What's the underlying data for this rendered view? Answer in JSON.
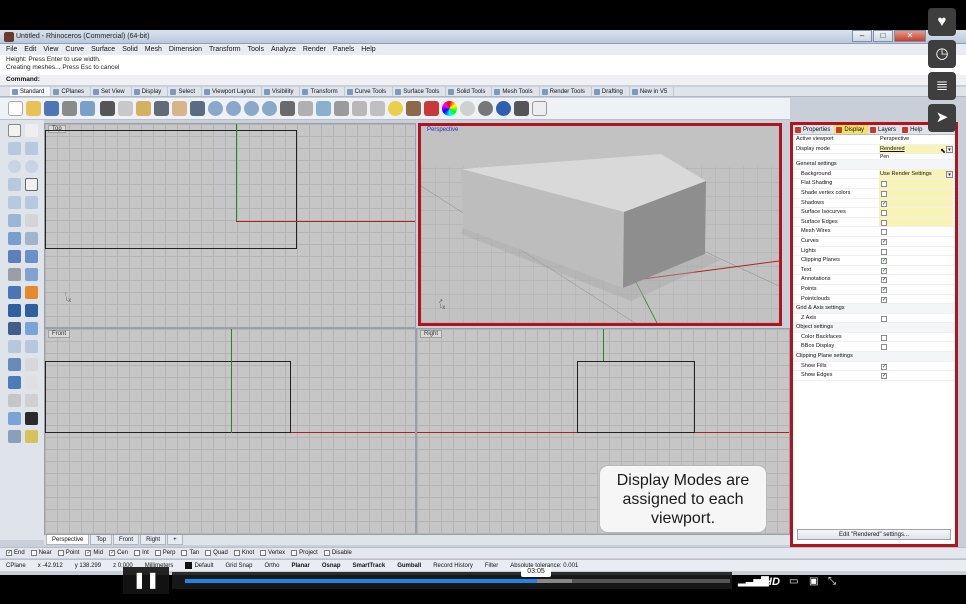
{
  "window": {
    "title": "Untitled - Rhinoceros (Commercial) (64-bit)",
    "min_glyph": "–",
    "max_glyph": "□",
    "close_glyph": "✕"
  },
  "menu": [
    "File",
    "Edit",
    "View",
    "Curve",
    "Surface",
    "Solid",
    "Mesh",
    "Dimension",
    "Transform",
    "Tools",
    "Analyze",
    "Render",
    "Panels",
    "Help"
  ],
  "command_history": [
    "Height: Press Enter to use width.",
    "Creating meshes... Press Esc to cancel"
  ],
  "command_prompt": "Command:",
  "toolbar_tabs": [
    "Standard",
    "CPlanes",
    "Set View",
    "Display",
    "Select",
    "Viewport Layout",
    "Visibility",
    "Transform",
    "Curve Tools",
    "Surface Tools",
    "Solid Tools",
    "Mesh Tools",
    "Render Tools",
    "Drafting",
    "New in V5"
  ],
  "viewports": {
    "top": "Top",
    "perspective": "Perspective",
    "front": "Front",
    "right": "Right"
  },
  "viewport_tabs": [
    "Perspective",
    "Top",
    "Front",
    "Right",
    "+"
  ],
  "osnap": [
    {
      "label": "End",
      "checked": true
    },
    {
      "label": "Near",
      "checked": false
    },
    {
      "label": "Point",
      "checked": false
    },
    {
      "label": "Mid",
      "checked": true
    },
    {
      "label": "Cen",
      "checked": true
    },
    {
      "label": "Int",
      "checked": false
    },
    {
      "label": "Perp",
      "checked": false
    },
    {
      "label": "Tan",
      "checked": false
    },
    {
      "label": "Quad",
      "checked": false
    },
    {
      "label": "Knot",
      "checked": false
    },
    {
      "label": "Vertex",
      "checked": false
    },
    {
      "label": "Project",
      "checked": false
    },
    {
      "label": "Disable",
      "checked": false
    }
  ],
  "status": {
    "cplane": "CPlane",
    "x": "x -42.912",
    "y": "y 138.299",
    "z": "z 0.000",
    "units": "Millimeters",
    "layer": "Default",
    "grid_snap": "Grid Snap",
    "ortho": "Ortho",
    "planar": "Planar",
    "osnap": "Osnap",
    "smarttrack": "SmartTrack",
    "gumball": "Gumball",
    "record_history": "Record History",
    "filter": "Filter",
    "tolerance": "Absolute tolerance: 0.001"
  },
  "panel": {
    "tabs": [
      "Properties",
      "Display",
      "Layers",
      "Help"
    ],
    "active_viewport_label": "Active viewport",
    "active_viewport_value": "Perspective",
    "display_mode_label": "Display mode",
    "display_mode_value": "Rendered",
    "display_mode_next": "Pen",
    "general_settings": "General settings",
    "background_label": "Background",
    "background_value": "Use Render Settings",
    "general_rows": [
      {
        "label": "Flat Shading",
        "checked": false
      },
      {
        "label": "Shade vertex colors",
        "checked": false
      },
      {
        "label": "Shadows",
        "checked": true
      },
      {
        "label": "Surface Isocurves",
        "checked": false
      },
      {
        "label": "Surface Edges",
        "checked": false
      },
      {
        "label": "Mesh Wires",
        "checked": false
      },
      {
        "label": "Curves",
        "checked": true
      },
      {
        "label": "Lights",
        "checked": false
      },
      {
        "label": "Clipping Planes",
        "checked": true
      },
      {
        "label": "Text",
        "checked": true
      },
      {
        "label": "Annotations",
        "checked": true
      },
      {
        "label": "Points",
        "checked": true
      },
      {
        "label": "Pointclouds",
        "checked": true
      }
    ],
    "grid_axis_settings": "Grid & Axis settings",
    "z_axis_label": "Z Axis",
    "object_settings": "Object settings",
    "color_backfaces_label": "Color Backfaces",
    "bbox_display_label": "BBox Display",
    "clipping_plane_settings": "Clipping Plane settings",
    "show_fills_label": "Show Fills",
    "show_edges_label": "Show Edges",
    "edit_button": "Edit \"Rendered\" settings..."
  },
  "callout": {
    "line1": "Display Modes are",
    "line2": "assigned to each",
    "line3": "viewport."
  },
  "player": {
    "time": "03:05",
    "play_state": "pause",
    "progress_fraction": 0.645,
    "buffered_fraction": 0.71,
    "hd_label": "HD"
  },
  "colors": {
    "highlight_border": "#b0141c",
    "progress": "#1f86e8",
    "x_axis": "#b02020",
    "y_axis": "#1f8a1f"
  }
}
